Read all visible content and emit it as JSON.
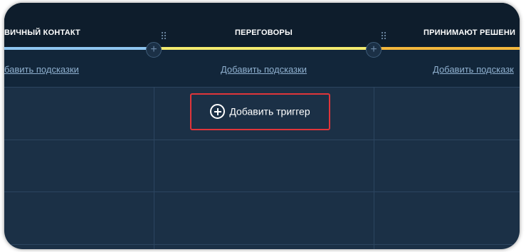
{
  "columns": [
    {
      "title": "ВИЧНЫЙ КОНТАКТ",
      "hint_link": "бавить подсказки",
      "color": "#8ec5f0"
    },
    {
      "title": "ПЕРЕГОВОРЫ",
      "hint_link": "Добавить подсказки",
      "color": "#f2ea6e"
    },
    {
      "title": "ПРИНИМАЮТ РЕШЕНИ",
      "hint_link": "Добавить подсказк",
      "color": "#f3b73c"
    }
  ],
  "add_trigger": {
    "label": "Добавить триггер",
    "icon": "plus-circle-icon",
    "highlight_color": "#e0353a"
  },
  "add_stage_icon": "plus-icon"
}
